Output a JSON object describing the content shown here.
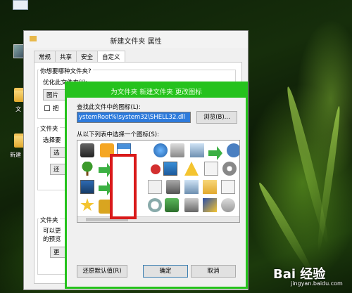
{
  "desktop": {
    "icon_labels": [
      "文",
      "新建"
    ]
  },
  "properties_window": {
    "title": "新建文件夹 属性",
    "tabs": [
      "常规",
      "共享",
      "安全",
      "自定义"
    ],
    "active_tab": "自定义",
    "question": "你想要哪种文件夹?",
    "optimize_label": "优化此文件夹(I):",
    "optimize_value": "图片",
    "checkbox_label": "把",
    "group2_label": "文件夹",
    "choose_label": "选择要",
    "btn_a": "选",
    "btn_b": "还",
    "group3_label": "文件夹",
    "text_a": "可以更",
    "text_b": "的预览",
    "btn_c": "更"
  },
  "change_icon_dialog": {
    "title": "为文件夹 新建文件夹 更改图标",
    "find_label": "查找此文件中的图标(L):",
    "path_value": "ystemRoot%\\system32\\SHELL32.dll",
    "browse_button": "浏览(B)...",
    "list_label": "从以下列表中选择一个图标(S):",
    "restore_button": "还原默认值(R)",
    "ok_button": "确定",
    "cancel_button": "取消",
    "highlight_color": "#25c21d",
    "annotation_color": "#d91a1a"
  },
  "watermark": {
    "brand": "Bai 经验",
    "url": "jingyan.baidu.com"
  }
}
